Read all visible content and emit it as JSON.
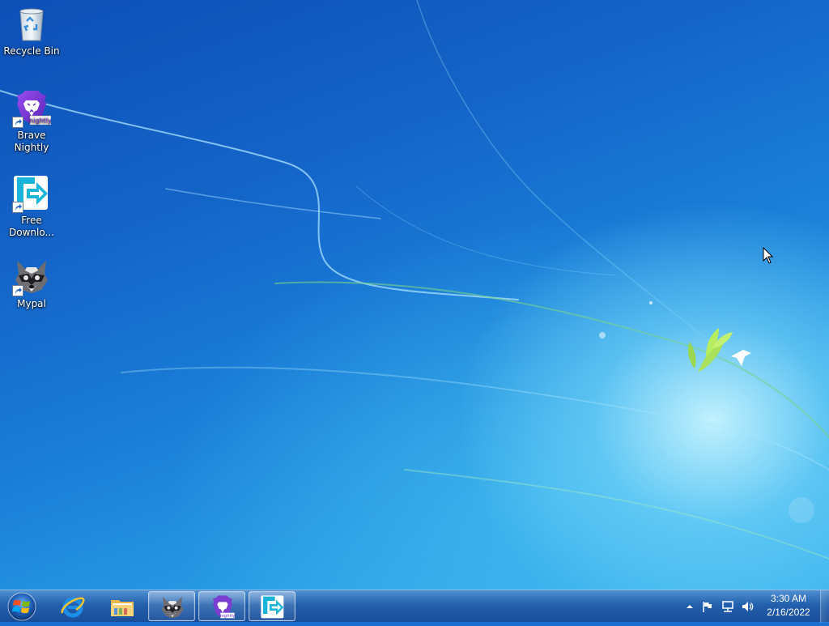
{
  "desktop": {
    "icons": [
      {
        "label": "Recycle Bin",
        "icon": "recycle-bin-icon",
        "shortcut": false
      },
      {
        "label": "Brave Nightly",
        "icon": "brave-nightly-icon",
        "shortcut": true
      },
      {
        "label": "Free Downlo...",
        "icon": "free-download-manager-icon",
        "shortcut": true
      },
      {
        "label": "Mypal",
        "icon": "mypal-icon",
        "shortcut": true
      }
    ],
    "brave_badge": "nightly"
  },
  "taskbar": {
    "pinned": [
      {
        "name": "internet-explorer",
        "icon": "internet-explorer-icon",
        "active": false
      },
      {
        "name": "windows-explorer",
        "icon": "folder-icon",
        "active": false
      },
      {
        "name": "mypal",
        "icon": "mypal-icon",
        "active": true
      },
      {
        "name": "brave-nightly",
        "icon": "brave-nightly-icon",
        "active": true
      },
      {
        "name": "free-download-manager",
        "icon": "free-download-manager-icon",
        "active": true
      }
    ],
    "tray": {
      "icons": [
        "show-hidden-icons-arrow",
        "action-center-flag-icon",
        "network-icon",
        "volume-icon"
      ]
    },
    "clock": {
      "time": "3:30 AM",
      "date": "2/16/2022"
    }
  },
  "colors": {
    "taskbar": "#2a5fa8",
    "wallpaper_dark": "#0d4fb6",
    "wallpaper_light": "#bff0ff",
    "fdm_accent": "#1ab4d8",
    "brave_purple": "#7a3fd0"
  }
}
